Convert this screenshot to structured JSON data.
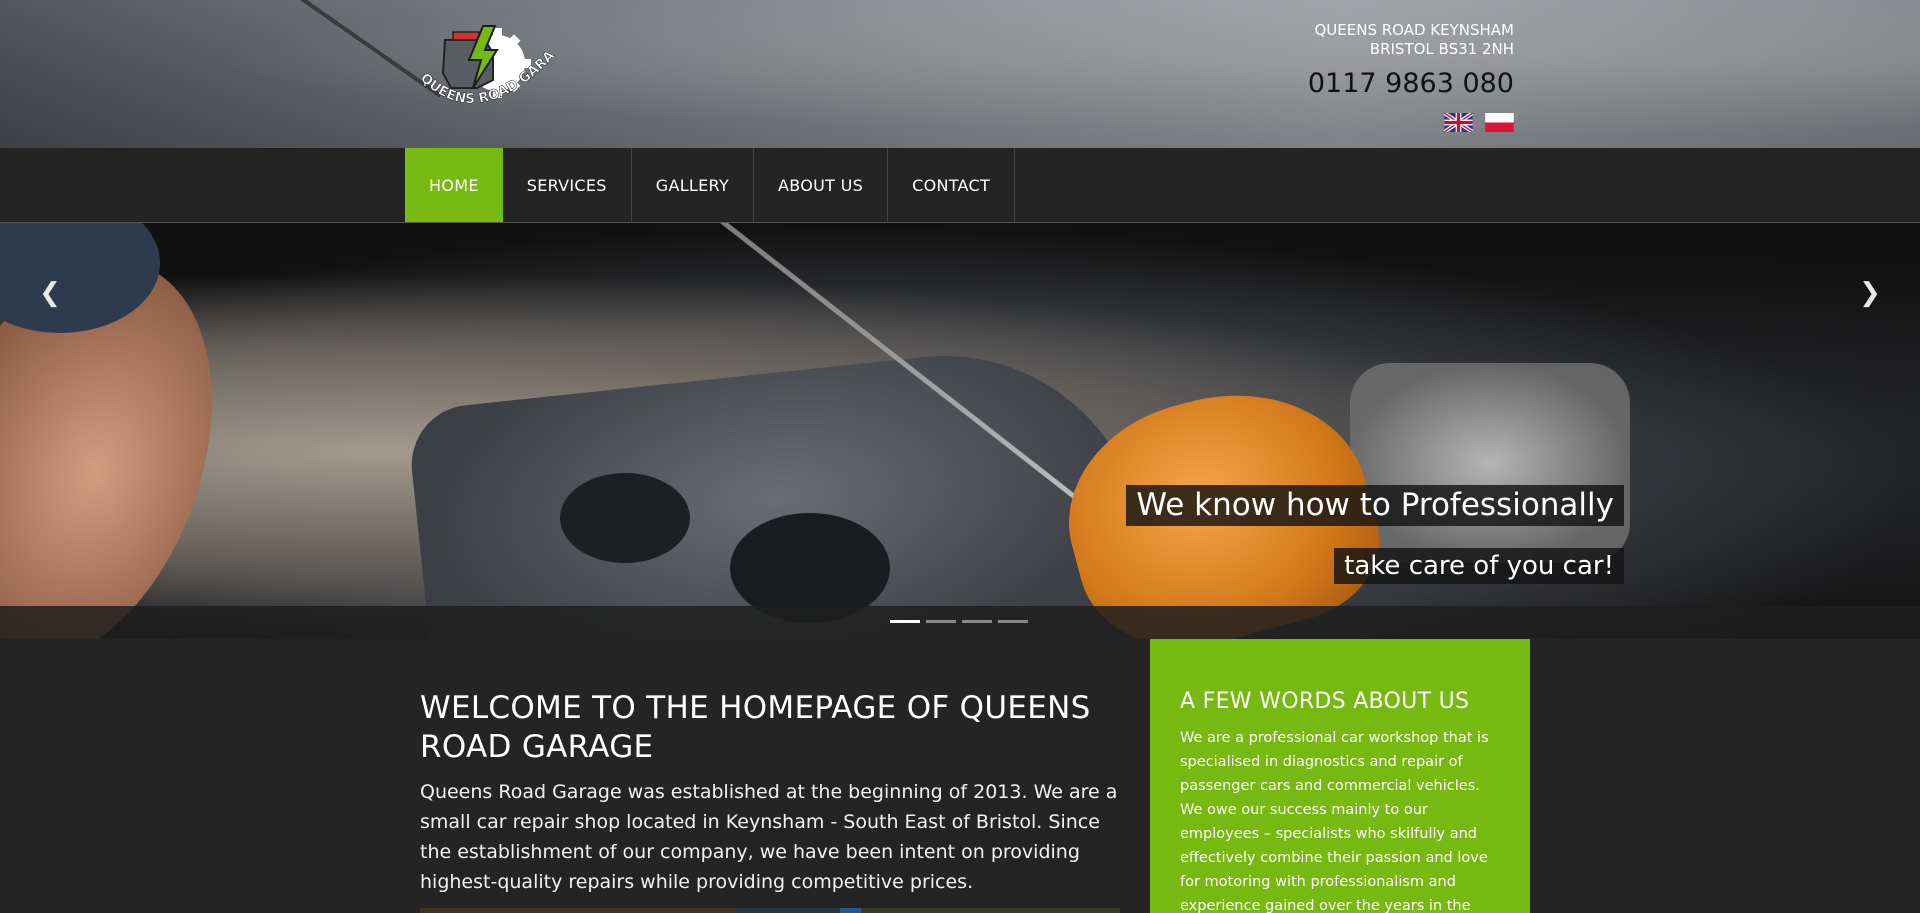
{
  "header": {
    "logo_text": "QUEENS ROAD GARAGE",
    "address_line1": "QUEENS ROAD KEYNSHAM",
    "address_line2": "BRISTOL BS31 2NH",
    "phone": "0117 9863 080",
    "languages": [
      "english-flag-icon",
      "polish-flag-icon"
    ]
  },
  "nav": {
    "items": [
      {
        "label": "HOME",
        "active": true
      },
      {
        "label": "SERVICES"
      },
      {
        "label": "GALLERY"
      },
      {
        "label": "ABOUT US"
      },
      {
        "label": "CONTACT"
      }
    ]
  },
  "slider": {
    "caption_line1": "We know how to Professionally",
    "caption_line2": "take care of you car!",
    "prev_icon": "chevron-left-icon",
    "next_icon": "chevron-right-icon",
    "slide_count": 4,
    "active_slide": 1
  },
  "welcome": {
    "title": "WELCOME TO THE HOMEPAGE OF QUEENS ROAD GARAGE",
    "body": "Queens Road Garage was established at the beginning of 2013. We are a small car repair shop located in Keynsham - South East of Bristol. Since the establishment of our company, we have been intent on providing highest-quality repairs while providing competitive prices."
  },
  "about": {
    "title": "A FEW WORDS ABOUT US",
    "body": "We are a professional car workshop that is specialised in diagnostics and repair of passenger cars and commercial vehicles. We owe our success mainly to our employees – specialists who skilfully and effectively combine their passion and love for motoring with professionalism and experience gained over the years in the automotive industry. We"
  },
  "colors": {
    "accent": "#75b911",
    "dark": "#242424"
  }
}
